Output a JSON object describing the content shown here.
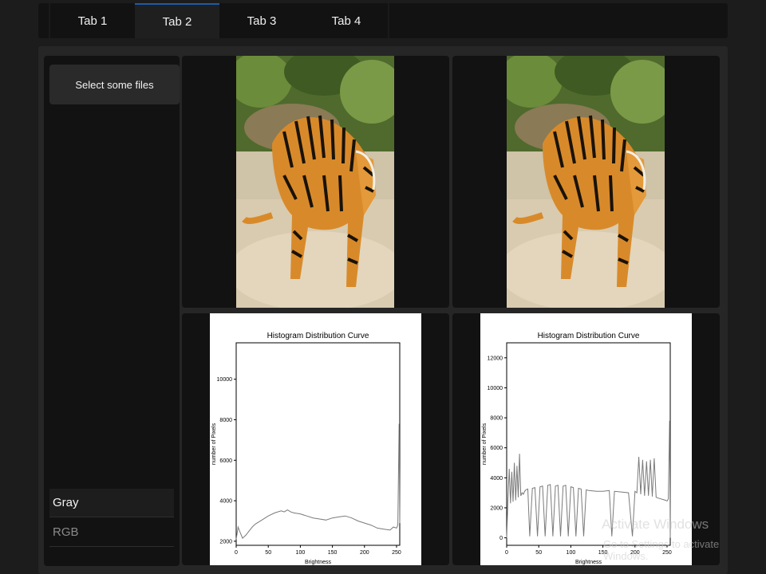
{
  "tabs": [
    {
      "label": "Tab 1",
      "active": false
    },
    {
      "label": "Tab 2",
      "active": true
    },
    {
      "label": "Tab 3",
      "active": false
    },
    {
      "label": "Tab 4",
      "active": false
    }
  ],
  "sidebar": {
    "file_button": "Select some files",
    "modes": [
      {
        "label": "Gray",
        "selected": true
      },
      {
        "label": "RGB",
        "selected": false
      }
    ]
  },
  "images": {
    "original_alt": "tiger",
    "processed_alt": "tiger"
  },
  "watermark": {
    "line1": "Activate Windows",
    "line2": "Go to Settings to activate Windows."
  },
  "colors": {
    "accent": "#1e5aa8",
    "background": "#1c1c1c",
    "panel": "#121212"
  },
  "chart_data": [
    {
      "type": "line",
      "title": "Histogram Distribution Curve",
      "xlabel": "Brightness",
      "ylabel": "number of Pixels",
      "xlim": [
        0,
        255
      ],
      "ylim": [
        1800,
        11800
      ],
      "xticks": [
        0,
        50,
        100,
        150,
        200,
        250
      ],
      "yticks": [
        2000,
        4000,
        6000,
        8000,
        10000
      ],
      "x": [
        0,
        3,
        6,
        10,
        15,
        20,
        25,
        30,
        40,
        50,
        60,
        70,
        75,
        80,
        85,
        90,
        100,
        110,
        120,
        130,
        140,
        150,
        160,
        170,
        180,
        190,
        200,
        210,
        220,
        230,
        240,
        245,
        250,
        252,
        254,
        255
      ],
      "y": [
        2100,
        2700,
        2450,
        2150,
        2300,
        2500,
        2700,
        2850,
        3050,
        3250,
        3400,
        3500,
        3450,
        3550,
        3450,
        3400,
        3350,
        3250,
        3150,
        3100,
        3050,
        3150,
        3200,
        3250,
        3150,
        3000,
        2900,
        2800,
        2650,
        2600,
        2550,
        2700,
        2650,
        2800,
        7800,
        2900
      ],
      "grid": false,
      "legend": "none"
    },
    {
      "type": "line",
      "title": "Histogram Distribution Curve",
      "xlabel": "Brightness",
      "ylabel": "number of Pixels",
      "xlim": [
        0,
        255
      ],
      "ylim": [
        -500,
        13000
      ],
      "xticks": [
        0,
        50,
        100,
        150,
        200,
        250
      ],
      "yticks": [
        0,
        2000,
        4000,
        6000,
        8000,
        10000,
        12000
      ],
      "x": [
        0,
        2,
        4,
        6,
        8,
        10,
        12,
        14,
        16,
        18,
        20,
        22,
        24,
        26,
        28,
        30,
        33,
        36,
        40,
        44,
        48,
        52,
        56,
        60,
        64,
        68,
        72,
        76,
        80,
        84,
        88,
        92,
        96,
        100,
        104,
        108,
        112,
        116,
        120,
        124,
        128,
        140,
        150,
        160,
        164,
        168,
        180,
        190,
        196,
        200,
        203,
        206,
        209,
        212,
        215,
        218,
        221,
        224,
        227,
        230,
        233,
        236,
        240,
        244,
        248,
        250,
        252,
        254,
        255
      ],
      "y": [
        0,
        2600,
        4600,
        2300,
        4400,
        2400,
        5000,
        2500,
        4800,
        2700,
        5600,
        2800,
        3000,
        2900,
        3100,
        3200,
        3250,
        100,
        3300,
        3350,
        100,
        3400,
        3450,
        100,
        3500,
        3550,
        100,
        3450,
        3500,
        100,
        3450,
        3500,
        100,
        3400,
        3350,
        100,
        3300,
        3250,
        100,
        3200,
        3150,
        3100,
        3100,
        3150,
        100,
        3100,
        3050,
        3000,
        100,
        3100,
        3000,
        5400,
        2900,
        5200,
        2800,
        5100,
        2800,
        5200,
        2750,
        5300,
        2700,
        2650,
        2600,
        2550,
        2500,
        2450,
        2600,
        7800,
        0
      ],
      "grid": false,
      "legend": "none"
    }
  ]
}
